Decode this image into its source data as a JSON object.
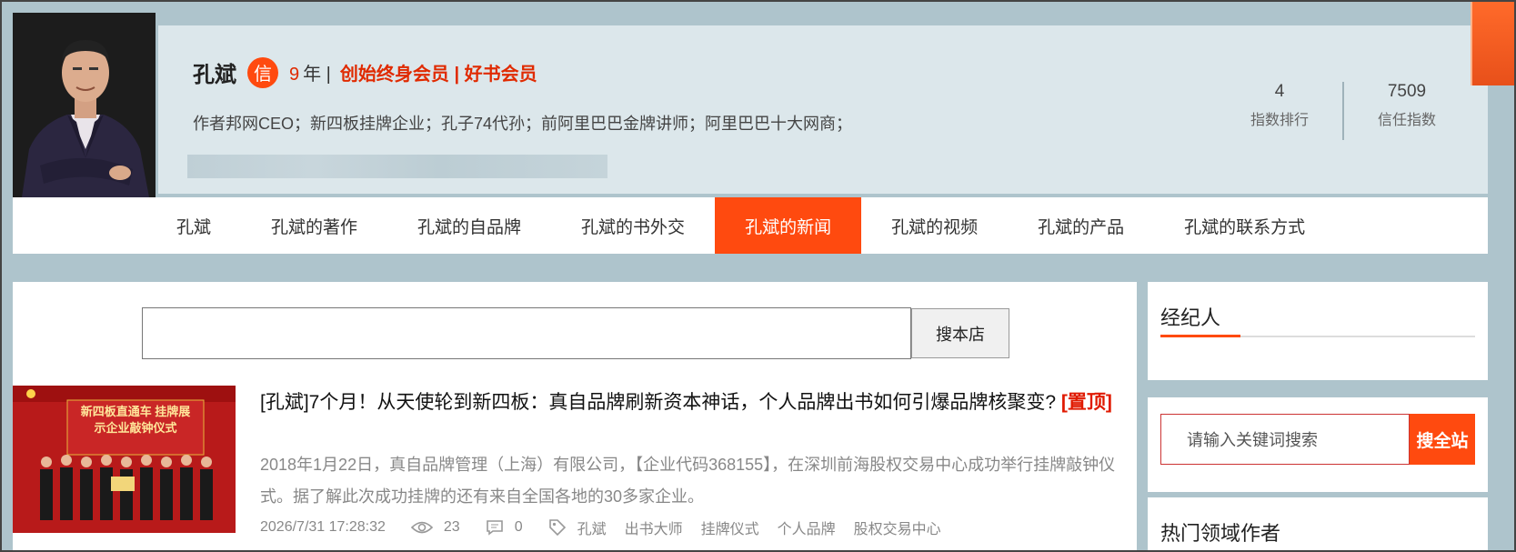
{
  "profile": {
    "name": "孔斌",
    "badge": "信",
    "years_num": "9",
    "years_suffix": "年 |",
    "membership": "创始终身会员 | 好书会员",
    "bio": "作者邦网CEO；新四板挂牌企业；孔子74代孙；前阿里巴巴金牌讲师；阿里巴巴十大网商；",
    "stats": [
      {
        "value": "4",
        "label": "指数排行"
      },
      {
        "value": "7509",
        "label": "信任指数"
      }
    ]
  },
  "nav": {
    "items": [
      {
        "label": "孔斌"
      },
      {
        "label": "孔斌的著作"
      },
      {
        "label": "孔斌的自品牌"
      },
      {
        "label": "孔斌的书外交"
      },
      {
        "label": "孔斌的新闻"
      },
      {
        "label": "孔斌的视频"
      },
      {
        "label": "孔斌的产品"
      },
      {
        "label": "孔斌的联系方式"
      }
    ],
    "active_index": 4
  },
  "store_search": {
    "value": "",
    "button": "搜本店"
  },
  "article": {
    "thumb_text": "新四板直通车 挂牌展示企业敲钟仪式",
    "title": "[孔斌]7个月！从天使轮到新四板：真自品牌刷新资本神话，个人品牌出书如何引爆品牌核聚变?",
    "pin": "[置顶]",
    "summary": "2018年1月22日，真自品牌管理（上海）有限公司，【企业代码368155】，在深圳前海股权交易中心成功举行挂牌敲钟仪式。据了解此次成功挂牌的还有来自全国各地的30多家企业。",
    "date": "2026/7/31 17:28:32",
    "views": "23",
    "comments": "0",
    "tags": [
      "孔斌",
      "出书大师",
      "挂牌仪式",
      "个人品牌",
      "股权交易中心"
    ]
  },
  "sidebar": {
    "agent_title": "经纪人",
    "global_search_placeholder": "请输入关键词搜索",
    "global_search_button": "搜全站",
    "authors_title": "热门领域作者"
  },
  "colors": {
    "accent": "#ff4a0f",
    "page_bg": "#aec4cc",
    "panel_bg": "#dce7eb",
    "highlight_red": "#e02a00"
  }
}
